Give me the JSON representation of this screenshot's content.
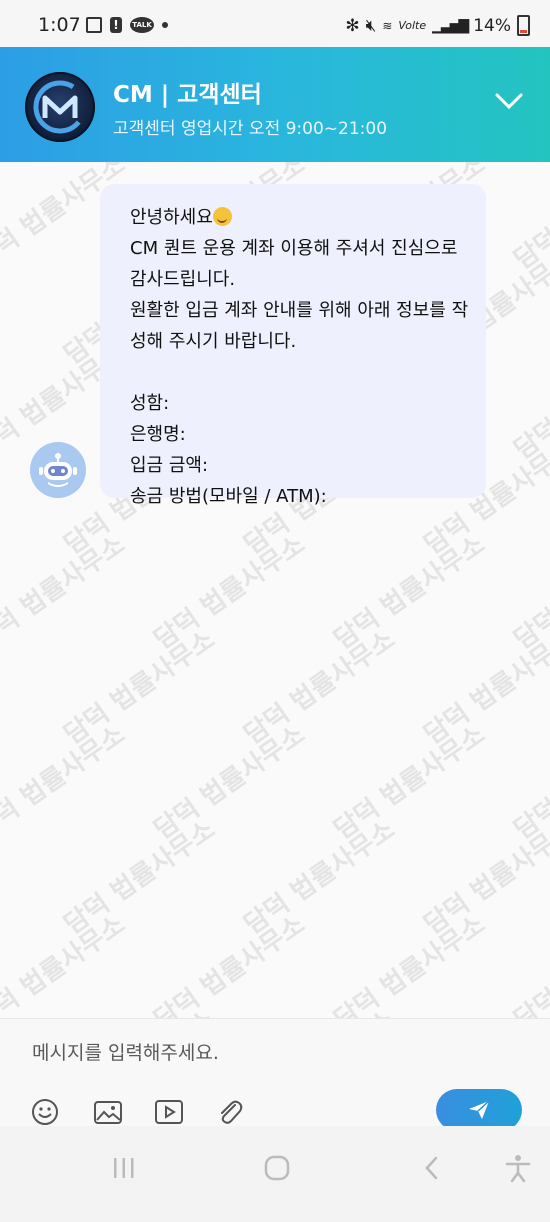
{
  "status": {
    "time": "1:07",
    "notification_icons": [
      "image-icon",
      "alert-icon",
      "talk-icon",
      "dot-icon"
    ],
    "system_icons": [
      "bluetooth-icon",
      "mute-icon",
      "wifi-icon",
      "volte-icon",
      "signal-icon"
    ],
    "wifi_label": "Vo))",
    "volte_label": "Volte",
    "talk_label": "TALK",
    "battery": "14%"
  },
  "header": {
    "title": "CM | 고객센터",
    "subtitle": "고객센터 영업시간 오전 9:00~21:00",
    "accent_start": "#2d9ee6",
    "accent_end": "#23c4c0"
  },
  "message": {
    "greeting": "안녕하세요",
    "line1": "CM 퀀트 운용 계좌 이용해 주셔서 진심으로",
    "line2": "감사드립니다.",
    "line3": "원활한 입금 계좌 안내를 위해 아래 정보를 작",
    "line4": "성해 주시기 바랍니다.",
    "field1": "성함:",
    "field2": "은행명:",
    "field3": "입금 금액:",
    "field4": "송금 방법(모바일 / ATM):"
  },
  "watermark": "담덕 법률사무소",
  "composer": {
    "placeholder": "메시지를 입력해주세요.",
    "tools": [
      "emoji-icon",
      "image-icon",
      "video-icon",
      "attach-icon"
    ]
  },
  "nav": [
    "recent-apps-icon",
    "home-icon",
    "back-icon",
    "accessibility-icon"
  ]
}
